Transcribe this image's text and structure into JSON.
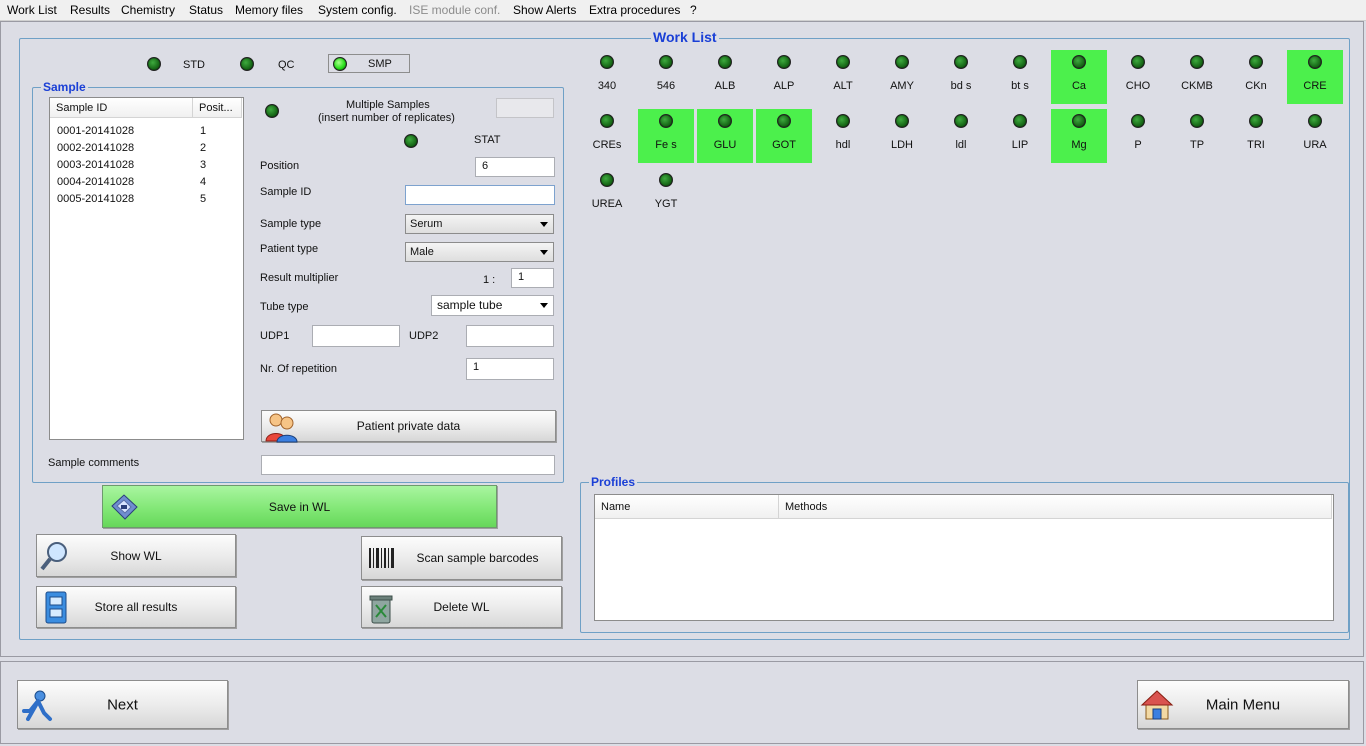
{
  "menu": [
    "Work List",
    "Results",
    "Chemistry",
    "Status",
    "Memory files",
    "System config.",
    "ISE module conf.",
    "Show Alerts",
    "Extra procedures",
    "?"
  ],
  "worklist_title": "Work List",
  "modes": {
    "std": "STD",
    "qc": "QC",
    "smp": "SMP"
  },
  "sample": {
    "title": "Sample",
    "columns": [
      "Sample ID",
      "Posit..."
    ],
    "rows": [
      [
        "0001-20141028",
        "1"
      ],
      [
        "0002-20141028",
        "2"
      ],
      [
        "0003-20141028",
        "3"
      ],
      [
        "0004-20141028",
        "4"
      ],
      [
        "0005-20141028",
        "5"
      ]
    ],
    "multiple_samples_label": "Multiple Samples",
    "multiple_samples_hint": "(insert number of replicates)",
    "multiple_samples_value": "",
    "stat_label": "STAT",
    "position_label": "Position",
    "position_value": "6",
    "sample_id_label": "Sample ID",
    "sample_id_value": "",
    "sample_type_label": "Sample type",
    "sample_type_value": "Serum",
    "patient_type_label": "Patient type",
    "patient_type_value": "Male",
    "result_multiplier_label": "Result multiplier",
    "multiplier_prefix": "1 :",
    "multiplier_value": "1",
    "tube_type_label": "Tube type",
    "tube_type_value": "sample tube",
    "udp1_label": "UDP1",
    "udp1_value": "",
    "udp2_label": "UDP2",
    "udp2_value": "",
    "repetition_label": "Nr. Of repetition",
    "repetition_value": "1",
    "patient_private_label": "Patient private data",
    "comments_label": "Sample comments",
    "comments_value": ""
  },
  "buttons": {
    "save_wl": "Save in WL",
    "show_wl": "Show WL",
    "scan": "Scan sample barcodes",
    "store_all": "Store all results",
    "delete_wl": "Delete WL",
    "next": "Next",
    "main_menu": "Main Menu"
  },
  "tests": [
    {
      "name": "340",
      "selected": false
    },
    {
      "name": "546",
      "selected": false
    },
    {
      "name": "ALB",
      "selected": false
    },
    {
      "name": "ALP",
      "selected": false
    },
    {
      "name": "ALT",
      "selected": false
    },
    {
      "name": "AMY",
      "selected": false
    },
    {
      "name": "bd s",
      "selected": false
    },
    {
      "name": "bt s",
      "selected": false
    },
    {
      "name": "Ca",
      "selected": true
    },
    {
      "name": "CHO",
      "selected": false
    },
    {
      "name": "CKMB",
      "selected": false
    },
    {
      "name": "CKn",
      "selected": false
    },
    {
      "name": "CRE",
      "selected": true
    },
    {
      "name": "CREs",
      "selected": false
    },
    {
      "name": "Fe s",
      "selected": true
    },
    {
      "name": "GLU",
      "selected": true
    },
    {
      "name": "GOT",
      "selected": true
    },
    {
      "name": "hdl",
      "selected": false
    },
    {
      "name": "LDH",
      "selected": false
    },
    {
      "name": "ldl",
      "selected": false
    },
    {
      "name": "LIP",
      "selected": false
    },
    {
      "name": "Mg",
      "selected": true
    },
    {
      "name": "P",
      "selected": false
    },
    {
      "name": "TP",
      "selected": false
    },
    {
      "name": "TRI",
      "selected": false
    },
    {
      "name": "URA",
      "selected": false
    },
    {
      "name": "UREA",
      "selected": false
    },
    {
      "name": "YGT",
      "selected": false
    }
  ],
  "profiles": {
    "title": "Profiles",
    "columns": [
      "Name",
      "Methods"
    ]
  },
  "colors": {
    "selected": "#4cf04c",
    "group_title": "#1a3fd6",
    "save_button": "#7fe673"
  }
}
